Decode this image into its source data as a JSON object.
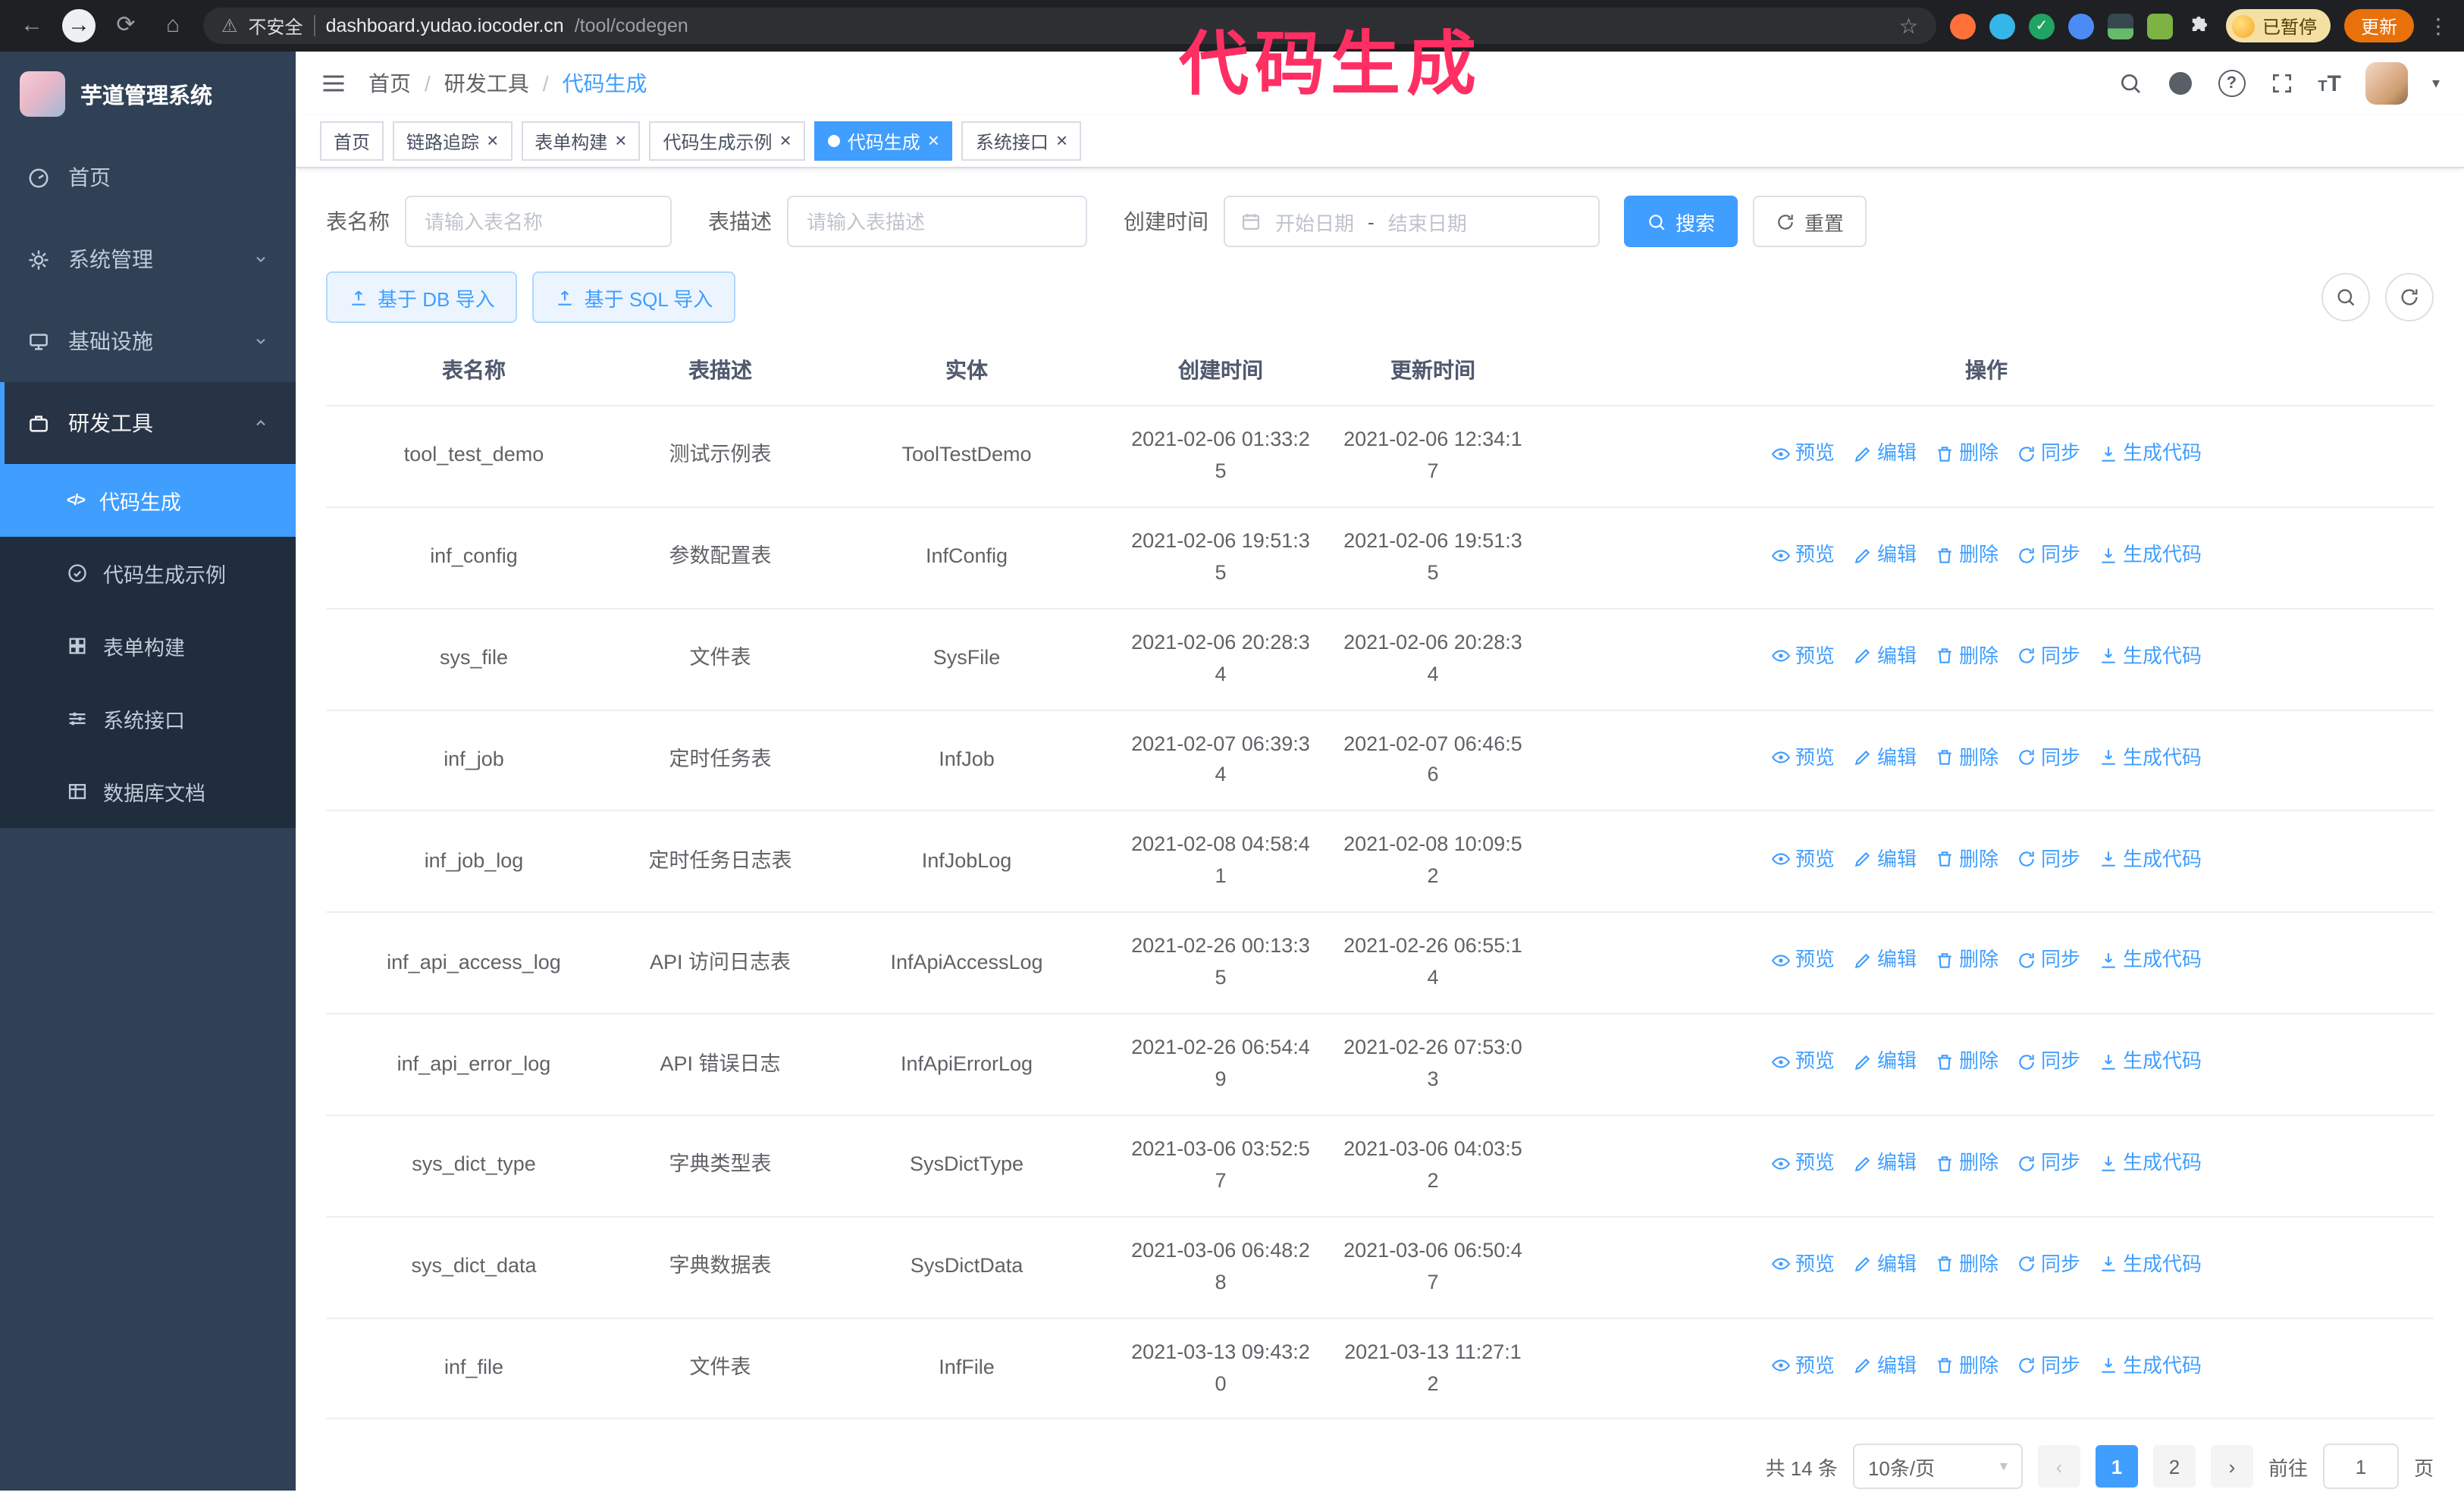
{
  "annotation": {
    "text": "代码生成"
  },
  "colors": {
    "accent": "#409eff",
    "sidebar_bg": "#304156",
    "submenu_bg": "#1f2d3d",
    "annotation": "#ff2f63",
    "update_button_bg": "#e8710a"
  },
  "browser": {
    "warning_text": "不安全",
    "url_host": "dashboard.yudao.iocoder.cn",
    "url_path": "/tool/codegen",
    "paused_label": "已暂停",
    "update_label": "更新"
  },
  "app": {
    "logo_title": "芋道管理系统",
    "menu": [
      {
        "label": "首页"
      },
      {
        "label": "系统管理"
      },
      {
        "label": "基础设施"
      },
      {
        "label": "研发工具"
      }
    ],
    "submenu": [
      {
        "label": "代码生成"
      },
      {
        "label": "代码生成示例"
      },
      {
        "label": "表单构建"
      },
      {
        "label": "系统接口"
      },
      {
        "label": "数据库文档"
      }
    ],
    "breadcrumb": [
      "首页",
      "研发工具",
      "代码生成"
    ],
    "tags": [
      {
        "label": "首页",
        "closable": false,
        "active": false
      },
      {
        "label": "链路追踪",
        "closable": true,
        "active": false
      },
      {
        "label": "表单构建",
        "closable": true,
        "active": false
      },
      {
        "label": "代码生成示例",
        "closable": true,
        "active": false
      },
      {
        "label": "代码生成",
        "closable": true,
        "active": true
      },
      {
        "label": "系统接口",
        "closable": true,
        "active": false
      }
    ]
  },
  "filters": {
    "table_name_label": "表名称",
    "table_name_placeholder": "请输入表名称",
    "table_desc_label": "表描述",
    "table_desc_placeholder": "请输入表描述",
    "create_time_label": "创建时间",
    "start_placeholder": "开始日期",
    "range_separator": "-",
    "end_placeholder": "结束日期",
    "search_label": "搜索",
    "reset_label": "重置"
  },
  "toolbar": {
    "import_db_label": "基于 DB 导入",
    "import_sql_label": "基于 SQL 导入"
  },
  "table": {
    "columns": [
      "表名称",
      "表描述",
      "实体",
      "创建时间",
      "更新时间",
      "操作"
    ],
    "action_labels": [
      "预览",
      "编辑",
      "删除",
      "同步",
      "生成代码"
    ],
    "rows": [
      {
        "name": "tool_test_demo",
        "desc": "测试示例表",
        "entity": "ToolTestDemo",
        "created": "2021-02-06 01:33:25",
        "updated": "2021-02-06 12:34:17"
      },
      {
        "name": "inf_config",
        "desc": "参数配置表",
        "entity": "InfConfig",
        "created": "2021-02-06 19:51:35",
        "updated": "2021-02-06 19:51:35"
      },
      {
        "name": "sys_file",
        "desc": "文件表",
        "entity": "SysFile",
        "created": "2021-02-06 20:28:34",
        "updated": "2021-02-06 20:28:34"
      },
      {
        "name": "inf_job",
        "desc": "定时任务表",
        "entity": "InfJob",
        "created": "2021-02-07 06:39:34",
        "updated": "2021-02-07 06:46:56"
      },
      {
        "name": "inf_job_log",
        "desc": "定时任务日志表",
        "entity": "InfJobLog",
        "created": "2021-02-08 04:58:41",
        "updated": "2021-02-08 10:09:52"
      },
      {
        "name": "inf_api_access_log",
        "desc": "API 访问日志表",
        "entity": "InfApiAccessLog",
        "created": "2021-02-26 00:13:35",
        "updated": "2021-02-26 06:55:14"
      },
      {
        "name": "inf_api_error_log",
        "desc": "API 错误日志",
        "entity": "InfApiErrorLog",
        "created": "2021-02-26 06:54:49",
        "updated": "2021-02-26 07:53:03"
      },
      {
        "name": "sys_dict_type",
        "desc": "字典类型表",
        "entity": "SysDictType",
        "created": "2021-03-06 03:52:57",
        "updated": "2021-03-06 04:03:52"
      },
      {
        "name": "sys_dict_data",
        "desc": "字典数据表",
        "entity": "SysDictData",
        "created": "2021-03-06 06:48:28",
        "updated": "2021-03-06 06:50:47"
      },
      {
        "name": "inf_file",
        "desc": "文件表",
        "entity": "InfFile",
        "created": "2021-03-13 09:43:20",
        "updated": "2021-03-13 11:27:12"
      }
    ]
  },
  "pagination": {
    "total_text": "共 14 条",
    "page_size_text": "10条/页",
    "pages": [
      "1",
      "2"
    ],
    "active_page": "1",
    "goto_label": "前往",
    "goto_value": "1",
    "unit_label": "页"
  }
}
